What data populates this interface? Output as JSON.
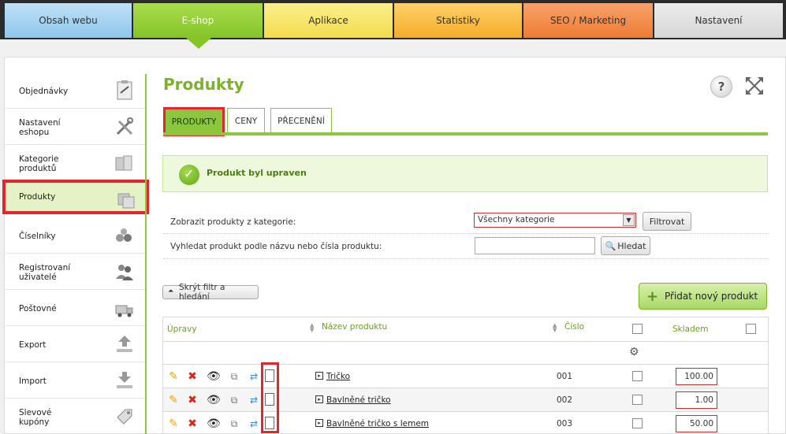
{
  "topnav": {
    "tabs": [
      "Obsah webu",
      "E-shop",
      "Aplikace",
      "Statistiky",
      "SEO / Marketing",
      "Nastavení"
    ]
  },
  "sidebar": {
    "items": [
      {
        "label": "Objednávky",
        "icon": "clipboard-icon"
      },
      {
        "label": "Nastavení eshopu",
        "icon": "tools-icon"
      },
      {
        "label": "Kategorie produktů",
        "icon": "boxes-icon"
      },
      {
        "label": "Produkty",
        "icon": "products-icon",
        "active": true
      },
      {
        "label": "Číselníky",
        "icon": "counters-icon"
      },
      {
        "label": "Registrovaní uživatelé",
        "icon": "users-icon"
      },
      {
        "label": "Poštovné",
        "icon": "truck-icon"
      },
      {
        "label": "Export",
        "icon": "upload-icon"
      },
      {
        "label": "Import",
        "icon": "download-icon"
      },
      {
        "label": "Slevové kupóny",
        "icon": "tag-icon"
      }
    ]
  },
  "page": {
    "title": "Produkty",
    "help": "?",
    "tabs": [
      "PRODUKTY",
      "CENY",
      "PŘECENĚNÍ"
    ],
    "message": "Produkt byl upraven"
  },
  "filter": {
    "category_label": "Zobrazit produkty z kategorie:",
    "category_value": "Všechny kategorie",
    "filter_button": "Filtrovat",
    "search_label": "Vyhledat produkt podle názvu nebo čísla produktu:",
    "search_value": "",
    "search_button": "Hledat",
    "hide_button": "Skrýt filtr a hledání",
    "add_button": "Přidat nový produkt"
  },
  "table": {
    "headers": {
      "edit": "Úpravy",
      "name": "Název produktu",
      "number": "Číslo",
      "stock": "Skladem"
    },
    "rows": [
      {
        "name": "Tričko",
        "number": "001",
        "stock": "100.00"
      },
      {
        "name": "Bavlněné tričko",
        "number": "002",
        "stock": "1.00"
      },
      {
        "name": "Bavlněné tričko s lemem",
        "number": "003",
        "stock": "50.00"
      }
    ]
  },
  "colors": {
    "accent_green": "#8cc63f",
    "highlight_red": "#e0262f",
    "title_green": "#7cb228"
  }
}
